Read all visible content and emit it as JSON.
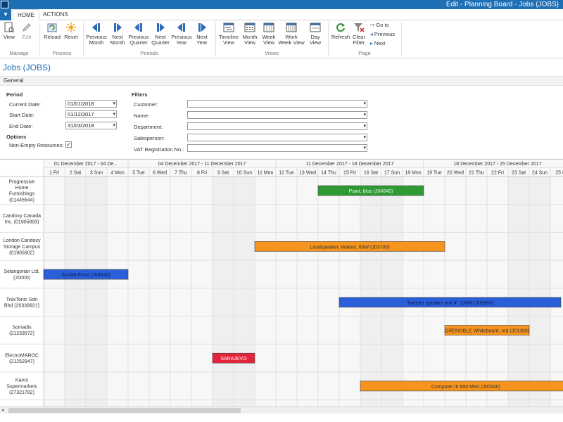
{
  "window": {
    "title": "Edit - Planning Board - Jobs (JOBS)"
  },
  "tabs": [
    {
      "label": "HOME"
    },
    {
      "label": "ACTIONS"
    }
  ],
  "ribbon": {
    "manage": {
      "group": "Manage",
      "view": "View",
      "edit": "Edit"
    },
    "process": {
      "group": "Process",
      "reload": "Reload",
      "reset": "Reset"
    },
    "periods": {
      "group": "Periods",
      "previous_month": [
        "Previous",
        "Month"
      ],
      "next_month": [
        "Next",
        "Month"
      ],
      "previous_quarter": [
        "Previous",
        "Quarter"
      ],
      "next_quarter": [
        "Next",
        "Quarter"
      ],
      "previous_year": [
        "Previous",
        "Year"
      ],
      "next_year": [
        "Next",
        "Year"
      ]
    },
    "views": {
      "group": "Views",
      "timeline": [
        "Timeline",
        "View"
      ],
      "month": [
        "Month",
        "View"
      ],
      "week": [
        "Week",
        "View"
      ],
      "work_week": [
        "Work",
        "Week View"
      ],
      "day": [
        "Day",
        "View"
      ]
    },
    "page": {
      "group": "Page",
      "refresh": "Refresh",
      "clear_filter": [
        "Clear",
        "Filter"
      ],
      "go_to": "Go to",
      "previous": "Previous",
      "next": "Next"
    }
  },
  "page_title": "Jobs (JOBS)",
  "general": "General",
  "period": {
    "heading": "Period",
    "current_date_label": "Current Date:",
    "current_date": "01/01/2018",
    "start_date_label": "Start Date:",
    "start_date": "01/12/2017",
    "end_date_label": "End Date:",
    "end_date": "31/03/2018"
  },
  "options": {
    "heading": "Options",
    "non_empty_label": "Non-Empty Resources:",
    "non_empty_checked": true
  },
  "filters": {
    "heading": "Filters",
    "customer": "Customer:",
    "name": "Name:",
    "department": "Department:",
    "salesperson": "Salesperson:",
    "vat": "VAT Registration No.:"
  },
  "board": {
    "weeks": [
      {
        "label": "01 December 2017 - 04 De...",
        "start": 0,
        "span": 4
      },
      {
        "label": "04 December 2017 - 11 December 2017",
        "start": 4,
        "span": 7
      },
      {
        "label": "11 December 2017 - 18 December 2017",
        "start": 11,
        "span": 7
      },
      {
        "label": "18 December 2017 - 25 December 2017",
        "start": 18,
        "span": 7
      },
      {
        "label": "25 M",
        "start": 25,
        "span": 1
      }
    ],
    "days": [
      "1 Fri",
      "2 Sat",
      "3 Sun",
      "4 Mon",
      "5 Tue",
      "6 Wed",
      "7 Thu",
      "8 Fri",
      "9 Sat",
      "10 Sun",
      "11 Mon",
      "12 Tue",
      "13 Wed",
      "14 Thu",
      "15 Fri",
      "16 Sat",
      "17 Sun",
      "18 Mon",
      "19 Tue",
      "20 Wed",
      "21 Thu",
      "22 Fri",
      "23 Sat",
      "24 Sun",
      "25 M"
    ],
    "resources": [
      {
        "lines": [
          "Progressive",
          "Home",
          "Furnishings",
          "(01445544)"
        ]
      },
      {
        "lines": [
          "Candoxy Canada",
          "Inc. (01905893)"
        ]
      },
      {
        "lines": [
          "London Candoxy",
          "Storage Campus",
          "(01905902)"
        ]
      },
      {
        "lines": [
          "Selangorian Ltd.",
          "(20000)"
        ]
      },
      {
        "lines": [
          "TraxTonic Sdn",
          "Bhd (20339921)"
        ]
      },
      {
        "lines": [
          "Somadis",
          "(21233572)"
        ]
      },
      {
        "lines": [
          "ElectroMAROC",
          "(21252947)"
        ]
      },
      {
        "lines": [
          "Karco",
          "Supermarkets",
          "(27321782)"
        ]
      }
    ],
    "bars": [
      {
        "row": 0,
        "start": 13,
        "end": 18,
        "label": "Paint, blue (J04840)",
        "color": "#2e9a33",
        "text": "#e8f5e8"
      },
      {
        "row": 2,
        "start": 10,
        "end": 19,
        "label": "Loudspeaker, Walnut, 80W (J03700)",
        "color": "#f7941d",
        "text": "#333333"
      },
      {
        "row": 3,
        "start": 0,
        "end": 4,
        "label": "Socket Front (J04530)",
        "color": "#2b5fd9",
        "text": "#0b1b4d"
      },
      {
        "row": 4,
        "start": 14,
        "end": 24.5,
        "label": "Tweeter speaker unit 4\" 100W (J00860)",
        "color": "#2b5fd9",
        "text": "#0b1b4d"
      },
      {
        "row": 5,
        "start": 19,
        "end": 23,
        "label": "GRENOBLE Whiteboard, red (J01300)",
        "color": "#f7941d",
        "text": "#333333"
      },
      {
        "row": 6,
        "start": 8,
        "end": 10,
        "label": "SARAJEVO",
        "color": "#e5233a",
        "text": "#ffffff"
      },
      {
        "row": 7,
        "start": 15,
        "end": 25,
        "label": "Computer III 800 MHz (J00340)",
        "color": "#f7941d",
        "text": "#333333"
      }
    ]
  }
}
